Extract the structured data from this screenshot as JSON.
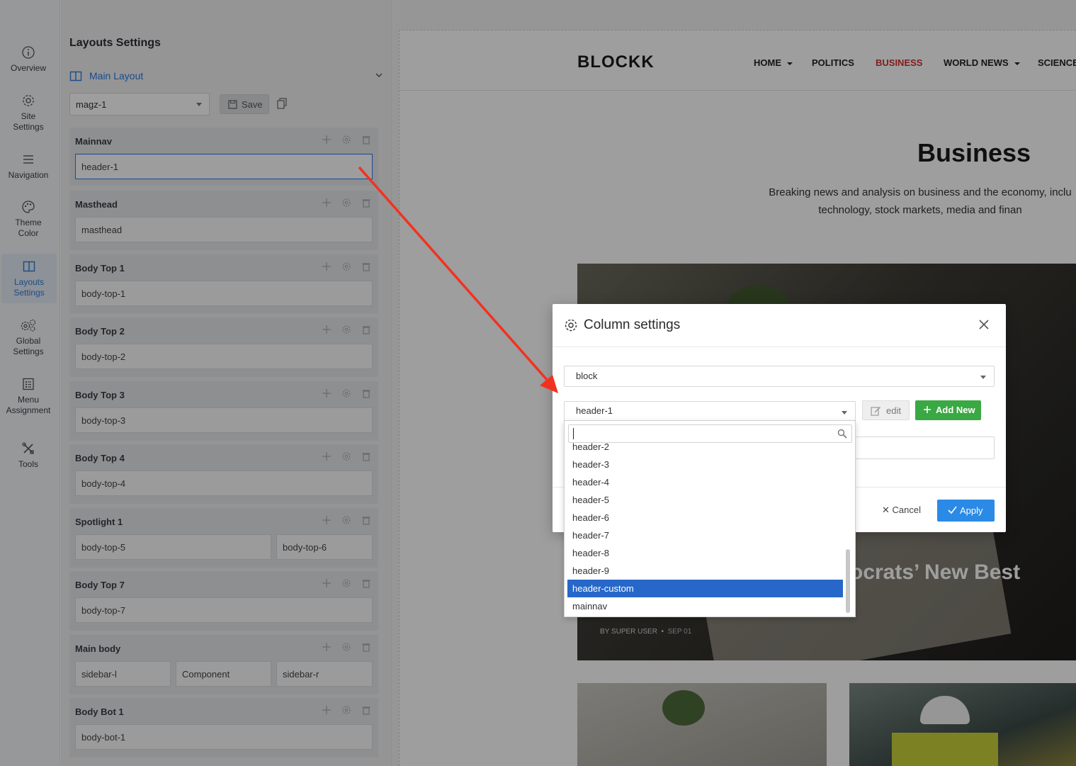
{
  "rail": {
    "items": [
      {
        "label1": "Overview",
        "label2": ""
      },
      {
        "label1": "Site",
        "label2": "Settings"
      },
      {
        "label1": "Navigation",
        "label2": ""
      },
      {
        "label1": "Theme",
        "label2": "Color"
      },
      {
        "label1": "Layouts",
        "label2": "Settings"
      },
      {
        "label1": "Global",
        "label2": "Settings"
      },
      {
        "label1": "Menu",
        "label2": "Assignment"
      },
      {
        "label1": "Tools",
        "label2": ""
      }
    ]
  },
  "panel": {
    "title": "Layouts Settings",
    "layout_name": "Main Layout",
    "layout_select_value": "magz-1",
    "save_label": "Save",
    "sections": [
      {
        "title": "Mainnav",
        "cells": [
          "header-1"
        ]
      },
      {
        "title": "Masthead",
        "cells": [
          "masthead"
        ]
      },
      {
        "title": "Body Top 1",
        "cells": [
          "body-top-1"
        ]
      },
      {
        "title": "Body Top 2",
        "cells": [
          "body-top-2"
        ]
      },
      {
        "title": "Body Top 3",
        "cells": [
          "body-top-3"
        ]
      },
      {
        "title": "Body Top 4",
        "cells": [
          "body-top-4"
        ]
      },
      {
        "title": "Spotlight 1",
        "cells": [
          "body-top-5",
          "body-top-6"
        ]
      },
      {
        "title": "Body Top 7",
        "cells": [
          "body-top-7"
        ]
      },
      {
        "title": "Main body",
        "cells": [
          "sidebar-l",
          "Component",
          "sidebar-r"
        ]
      },
      {
        "title": "Body Bot 1",
        "cells": [
          "body-bot-1"
        ]
      }
    ]
  },
  "site": {
    "brand": "BLOCKK",
    "nav": [
      "HOME",
      "POLITICS",
      "BUSINESS",
      "WORLD NEWS",
      "SCIENCE"
    ],
    "heading": "Business",
    "description": "Breaking news and analysis on business and the economy, inclu technology, stock markets, media and finan",
    "hero_title": "ocrats’ New Best",
    "hero_author": "BY SUPER USER",
    "hero_date": "SEP 01"
  },
  "modal": {
    "title": "Column settings",
    "type_select": "block",
    "block_select": "header-1",
    "edit_label": "edit",
    "add_new_label": "Add New",
    "cancel_label": "Cancel",
    "apply_label": "Apply"
  },
  "dropdown": {
    "search_value": "",
    "options": [
      "header-2",
      "header-3",
      "header-4",
      "header-5",
      "header-6",
      "header-7",
      "header-8",
      "header-9",
      "header-custom",
      "mainnav"
    ],
    "highlighted": "header-custom"
  },
  "colors": {
    "accent": "#2a7ae2",
    "nav_current": "#d32f2f",
    "add_new": "#3aa843",
    "apply": "#2a8ae6",
    "highlight": "#2767c9",
    "annotation_arrow": "#f2321f"
  }
}
